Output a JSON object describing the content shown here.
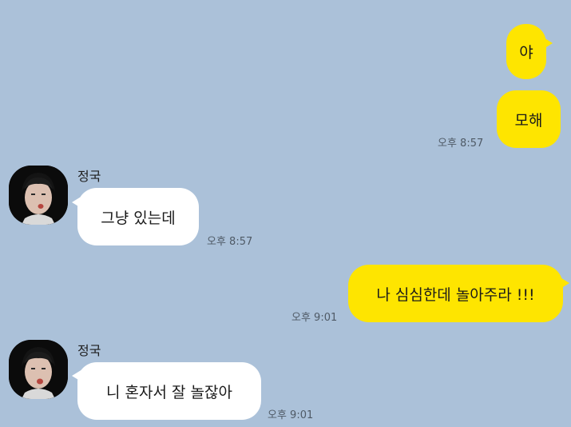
{
  "theme": {
    "background": "#abc1d9",
    "my_bubble_color": "#fee500",
    "other_bubble_color": "#ffffff"
  },
  "messages": [
    {
      "sender": "me",
      "text": "야",
      "time": ""
    },
    {
      "sender": "me",
      "text": "모해",
      "time": "오후 8:57"
    },
    {
      "sender": "other",
      "name": "정국",
      "text": "그냥 있는데",
      "time": "오후 8:57"
    },
    {
      "sender": "me",
      "text": "나 심심한데 놀아주라 !!!",
      "time": "오후 9:01"
    },
    {
      "sender": "other",
      "name": "정국",
      "text": "니 혼자서 잘 놀잖아",
      "time": "오후 9:01"
    }
  ],
  "icons": {
    "avatar": "profile-photo"
  }
}
